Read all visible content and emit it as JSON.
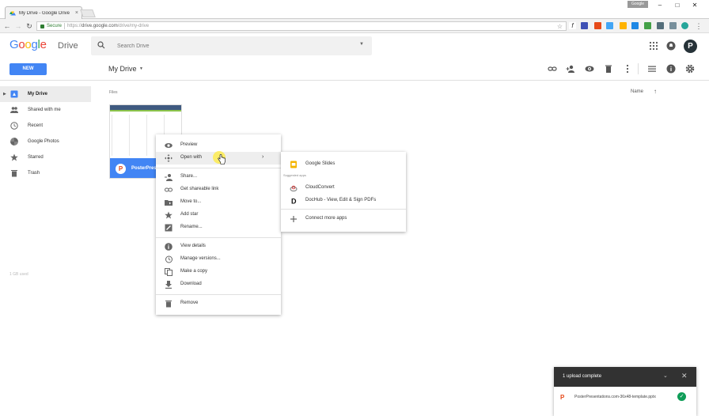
{
  "browser": {
    "tab_title": "My Drive - Google Drive",
    "window_user": "Google",
    "secure_label": "Secure",
    "url_scheme": "https://",
    "url_host": "drive.google.com",
    "url_path": "/drive/my-drive"
  },
  "drive": {
    "logo_google": [
      "G",
      "o",
      "o",
      "g",
      "l",
      "e"
    ],
    "logo_product": "Drive",
    "search_placeholder": "Search Drive",
    "new_button": "NEW",
    "location_title": "My Drive"
  },
  "sidebar": {
    "items": [
      {
        "label": "My Drive",
        "icon": "drive-icon",
        "active": true
      },
      {
        "label": "Shared with me",
        "icon": "people-icon"
      },
      {
        "label": "Recent",
        "icon": "clock-icon"
      },
      {
        "label": "Google Photos",
        "icon": "photos-icon"
      },
      {
        "label": "Starred",
        "icon": "star-icon"
      },
      {
        "label": "Trash",
        "icon": "trash-icon"
      }
    ],
    "storage_hint": "1 GB used"
  },
  "main": {
    "section_label": "Files",
    "sort_label": "Name",
    "file": {
      "name": "PosterPresentations"
    }
  },
  "context_menu": {
    "items": [
      {
        "label": "Preview",
        "icon": "eye-icon"
      },
      {
        "label": "Open with",
        "icon": "move-icon",
        "submenu": true
      },
      {
        "label": "Share...",
        "icon": "share-person-icon"
      },
      {
        "label": "Get shareable link",
        "icon": "link-icon"
      },
      {
        "label": "Move to...",
        "icon": "folder-move-icon"
      },
      {
        "label": "Add star",
        "icon": "star-icon"
      },
      {
        "label": "Rename...",
        "icon": "pencil-icon"
      },
      {
        "label": "View details",
        "icon": "info-icon"
      },
      {
        "label": "Manage versions...",
        "icon": "history-icon"
      },
      {
        "label": "Make a copy",
        "icon": "copy-icon"
      },
      {
        "label": "Download",
        "icon": "download-icon"
      },
      {
        "label": "Remove",
        "icon": "trash-icon"
      }
    ]
  },
  "open_with_menu": {
    "default_app": "Google Slides",
    "suggested_header": "Suggested apps",
    "apps": [
      "CloudConvert",
      "DocHub - View, Edit & Sign PDFs"
    ],
    "connect_more": "Connect more apps"
  },
  "upload": {
    "title": "1 upload complete",
    "file_name": "PosterPresentations.com-36x48-template.pptx"
  },
  "colors": {
    "accent": "#4285f4",
    "success": "#0f9d58",
    "dark_panel": "#323232"
  }
}
